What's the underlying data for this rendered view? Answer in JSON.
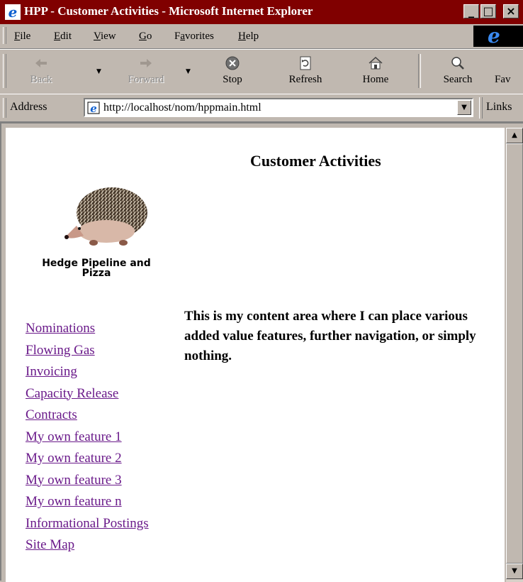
{
  "window": {
    "title": "HPP - Customer Activities - Microsoft Internet Explorer",
    "minimize": "_",
    "maximize": "□",
    "close": "×"
  },
  "menu": {
    "items": [
      {
        "acc": "F",
        "rest": "ile"
      },
      {
        "acc": "E",
        "rest": "dit"
      },
      {
        "acc": "V",
        "rest": "iew"
      },
      {
        "acc": "G",
        "rest": "o"
      },
      {
        "pre": "F",
        "acc": "a",
        "rest": "vorites"
      },
      {
        "acc": "H",
        "rest": "elp"
      }
    ]
  },
  "toolbar": {
    "back": "Back",
    "forward": "Forward",
    "stop": "Stop",
    "refresh": "Refresh",
    "home": "Home",
    "search": "Search",
    "favorites": "Fav"
  },
  "address": {
    "label": "Address",
    "url": "http://localhost/nom/hppmain.html",
    "links": "Links"
  },
  "page": {
    "title": "Customer Activities",
    "logo_caption_line1": "Hedge Pipeline and",
    "logo_caption_line2": "Pizza",
    "content": "This is my content area where I can place various added value features, further navigation, or simply nothing.",
    "nav": [
      "Nominations",
      "Flowing Gas",
      "Invoicing",
      "Capacity Release",
      "Contracts",
      "My own feature 1",
      "My own feature 2",
      "My own feature 3",
      "My own feature n",
      "Informational Postings",
      "Site Map"
    ]
  },
  "colors": {
    "titlebar": "#800000",
    "chrome": "#c0b8b0",
    "link_visited": "#6a1a8a"
  }
}
